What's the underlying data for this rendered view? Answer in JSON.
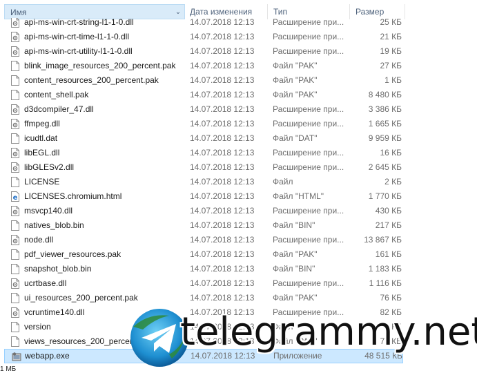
{
  "columns": {
    "name": "Имя",
    "date": "Дата изменения",
    "type": "Тип",
    "size": "Размер"
  },
  "files": [
    {
      "name": "api-ms-win-crt-string-l1-1-0.dll",
      "date": "14.07.2018 12:13",
      "type": "Расширение при...",
      "size": "25 КБ",
      "icon": "dll-icon"
    },
    {
      "name": "api-ms-win-crt-time-l1-1-0.dll",
      "date": "14.07.2018 12:13",
      "type": "Расширение при...",
      "size": "21 КБ",
      "icon": "dll-icon"
    },
    {
      "name": "api-ms-win-crt-utility-l1-1-0.dll",
      "date": "14.07.2018 12:13",
      "type": "Расширение при...",
      "size": "19 КБ",
      "icon": "dll-icon"
    },
    {
      "name": "blink_image_resources_200_percent.pak",
      "date": "14.07.2018 12:13",
      "type": "Файл \"PAK\"",
      "size": "27 КБ",
      "icon": "file-icon"
    },
    {
      "name": "content_resources_200_percent.pak",
      "date": "14.07.2018 12:13",
      "type": "Файл \"PAK\"",
      "size": "1 КБ",
      "icon": "file-icon"
    },
    {
      "name": "content_shell.pak",
      "date": "14.07.2018 12:13",
      "type": "Файл \"PAK\"",
      "size": "8 480 КБ",
      "icon": "file-icon"
    },
    {
      "name": "d3dcompiler_47.dll",
      "date": "14.07.2018 12:13",
      "type": "Расширение при...",
      "size": "3 386 КБ",
      "icon": "dll-icon"
    },
    {
      "name": "ffmpeg.dll",
      "date": "14.07.2018 12:13",
      "type": "Расширение при...",
      "size": "1 665 КБ",
      "icon": "dll-icon"
    },
    {
      "name": "icudtl.dat",
      "date": "14.07.2018 12:13",
      "type": "Файл \"DAT\"",
      "size": "9 959 КБ",
      "icon": "file-icon"
    },
    {
      "name": "libEGL.dll",
      "date": "14.07.2018 12:13",
      "type": "Расширение при...",
      "size": "16 КБ",
      "icon": "dll-icon"
    },
    {
      "name": "libGLESv2.dll",
      "date": "14.07.2018 12:13",
      "type": "Расширение при...",
      "size": "2 645 КБ",
      "icon": "dll-icon"
    },
    {
      "name": "LICENSE",
      "date": "14.07.2018 12:13",
      "type": "Файл",
      "size": "2 КБ",
      "icon": "file-icon"
    },
    {
      "name": "LICENSES.chromium.html",
      "date": "14.07.2018 12:13",
      "type": "Файл \"HTML\"",
      "size": "1 770 КБ",
      "icon": "html-icon"
    },
    {
      "name": "msvcp140.dll",
      "date": "14.07.2018 12:13",
      "type": "Расширение при...",
      "size": "430 КБ",
      "icon": "dll-icon"
    },
    {
      "name": "natives_blob.bin",
      "date": "14.07.2018 12:13",
      "type": "Файл \"BIN\"",
      "size": "217 КБ",
      "icon": "file-icon"
    },
    {
      "name": "node.dll",
      "date": "14.07.2018 12:13",
      "type": "Расширение при...",
      "size": "13 867 КБ",
      "icon": "dll-icon"
    },
    {
      "name": "pdf_viewer_resources.pak",
      "date": "14.07.2018 12:13",
      "type": "Файл \"PAK\"",
      "size": "161 КБ",
      "icon": "file-icon"
    },
    {
      "name": "snapshot_blob.bin",
      "date": "14.07.2018 12:13",
      "type": "Файл \"BIN\"",
      "size": "1 183 КБ",
      "icon": "file-icon"
    },
    {
      "name": "ucrtbase.dll",
      "date": "14.07.2018 12:13",
      "type": "Расширение при...",
      "size": "1 116 КБ",
      "icon": "dll-icon"
    },
    {
      "name": "ui_resources_200_percent.pak",
      "date": "14.07.2018 12:13",
      "type": "Файл \"PAK\"",
      "size": "76 КБ",
      "icon": "file-icon"
    },
    {
      "name": "vcruntime140.dll",
      "date": "14.07.2018 12:13",
      "type": "Расширение при...",
      "size": "82 КБ",
      "icon": "dll-icon"
    },
    {
      "name": "version",
      "date": "14.07.2018 12:13",
      "type": "Файл",
      "size": "1 КБ",
      "icon": "file-icon"
    },
    {
      "name": "views_resources_200_percent.pak",
      "date": "14.07.2018 12:13",
      "type": "Файл \"PAK\"",
      "size": "76 КБ",
      "icon": "file-icon"
    },
    {
      "name": "webapp.exe",
      "date": "14.07.2018 12:13",
      "type": "Приложение",
      "size": "48 515 КБ",
      "icon": "exe-icon",
      "selected": true
    }
  ],
  "status_text": "1 МБ",
  "watermark": {
    "text": "telegrammy.net",
    "logo": "telegram-logo"
  },
  "colors": {
    "header_selected": "#d9ebf9",
    "row_selected": "#cce8ff",
    "header_text": "#4c607a",
    "meta_text": "#6d6d6d",
    "telegram_blue": "#2aa3df"
  }
}
